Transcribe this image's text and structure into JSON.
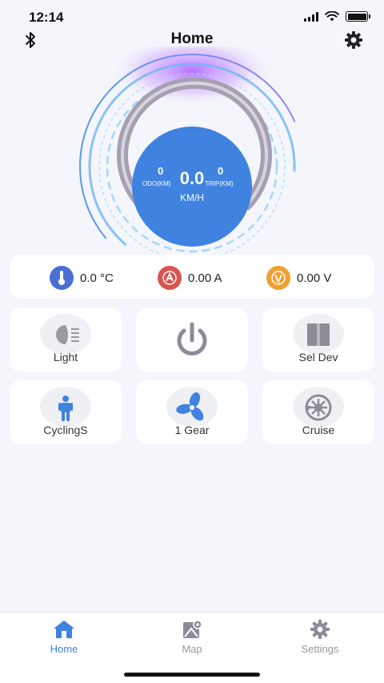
{
  "status_bar": {
    "time": "12:14"
  },
  "header": {
    "title": "Home"
  },
  "gauge": {
    "speed": "0.0",
    "speed_unit": "KM/H",
    "odo_value": "0",
    "odo_label": "ODO(KM)",
    "trip_value": "0",
    "trip_label": "TRIP(KM)"
  },
  "metrics": [
    {
      "icon": "thermometer-icon",
      "value": "0.0 °C",
      "color": "#4a6fd4"
    },
    {
      "icon": "current-icon",
      "value": "0.00 A",
      "color": "#d9534f"
    },
    {
      "icon": "voltage-icon",
      "value": "0.00 V",
      "color": "#f0a030"
    }
  ],
  "tiles": [
    {
      "icon": "headlight-icon",
      "label": "Light"
    },
    {
      "icon": "power-icon",
      "label": ""
    },
    {
      "icon": "device-select-icon",
      "label": "Sel Dev"
    },
    {
      "icon": "cyclist-icon",
      "label": "CyclingS"
    },
    {
      "icon": "fan-icon",
      "label": "1 Gear"
    },
    {
      "icon": "cruise-icon",
      "label": "Cruise"
    }
  ],
  "tabs": [
    {
      "icon": "home-icon",
      "label": "Home",
      "active": true
    },
    {
      "icon": "map-icon",
      "label": "Map",
      "active": false
    },
    {
      "icon": "settings-icon",
      "label": "Settings",
      "active": false
    }
  ],
  "colors": {
    "accent": "#3f82e0",
    "background": "#f4f6fb"
  }
}
